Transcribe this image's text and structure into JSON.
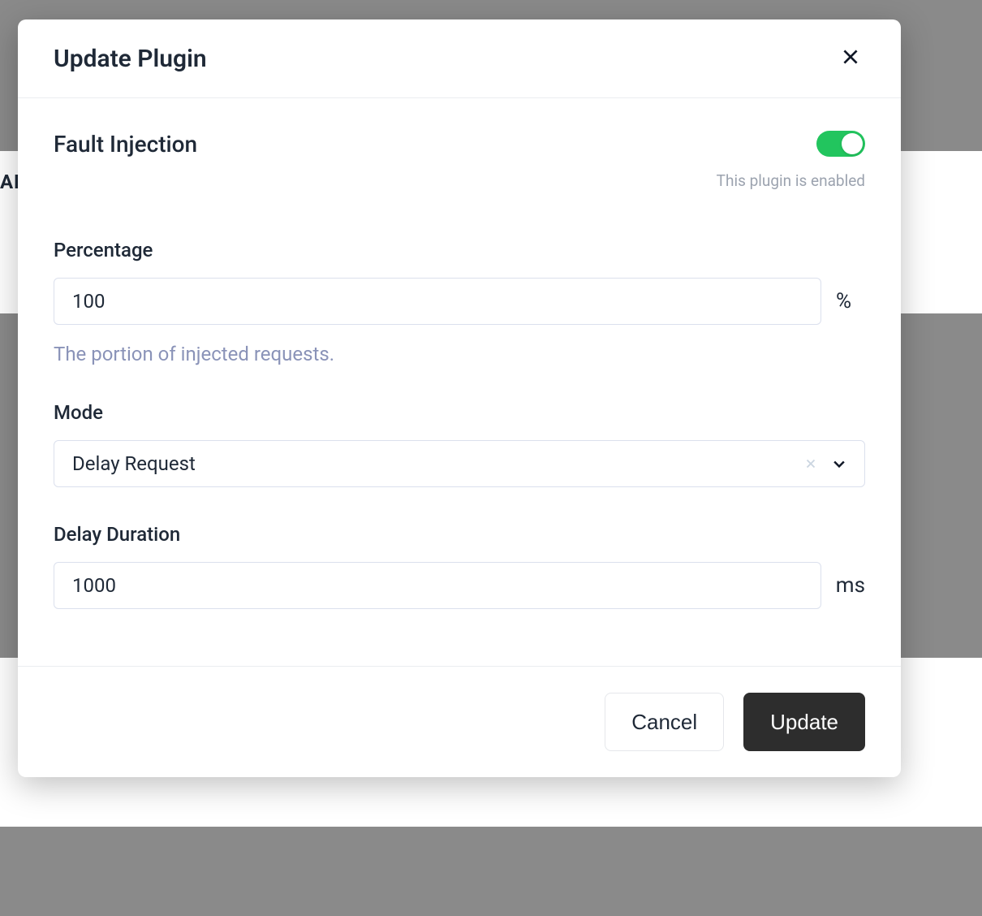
{
  "background": {
    "partial_text": "AB"
  },
  "modal": {
    "title": "Update Plugin",
    "plugin": {
      "name": "Fault Injection",
      "enabled": true,
      "enabled_hint": "This plugin is enabled"
    },
    "fields": {
      "percentage": {
        "label": "Percentage",
        "value": "100",
        "suffix": "%",
        "hint": "The portion of injected requests."
      },
      "mode": {
        "label": "Mode",
        "value": "Delay Request"
      },
      "delay_duration": {
        "label": "Delay Duration",
        "value": "1000",
        "suffix": "ms"
      }
    },
    "actions": {
      "cancel": "Cancel",
      "update": "Update"
    }
  }
}
